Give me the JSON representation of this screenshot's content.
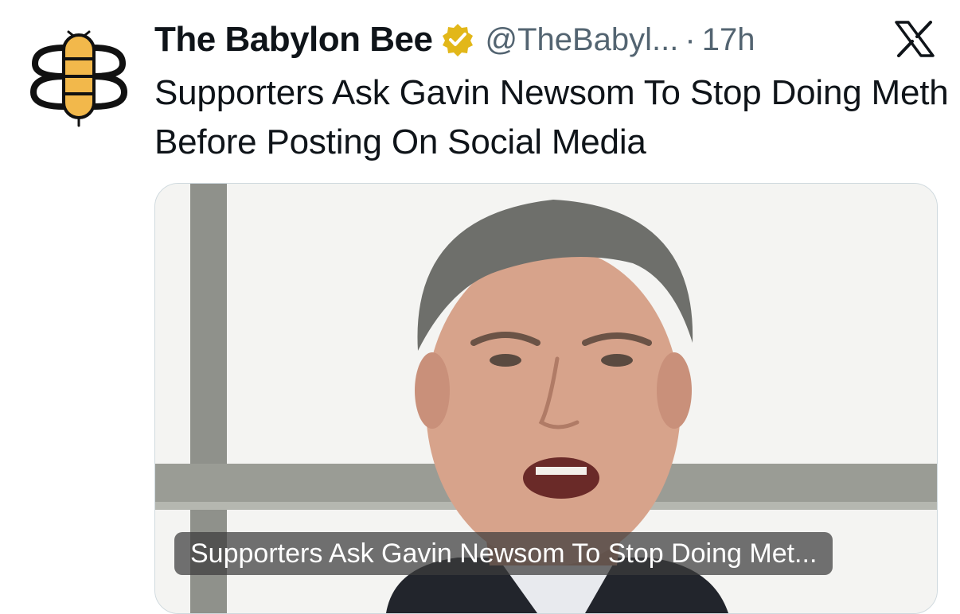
{
  "tweet": {
    "display_name": "The Babylon Bee",
    "handle": "@TheBabyl...",
    "separator": "·",
    "time": "17h",
    "text": "Supporters Ask Gavin Newsom To Stop Doing Meth Before Posting On Social Media"
  },
  "card": {
    "caption": "Supporters Ask Gavin Newsom To Stop Doing Met..."
  },
  "icons": {
    "avatar": "bee-logo-icon",
    "verified": "verified-badge-icon",
    "platform": "x-logo-icon"
  },
  "colors": {
    "gold_badge": "#e2b719",
    "bee_yellow": "#f2b84b",
    "secondary_text": "#536471"
  }
}
